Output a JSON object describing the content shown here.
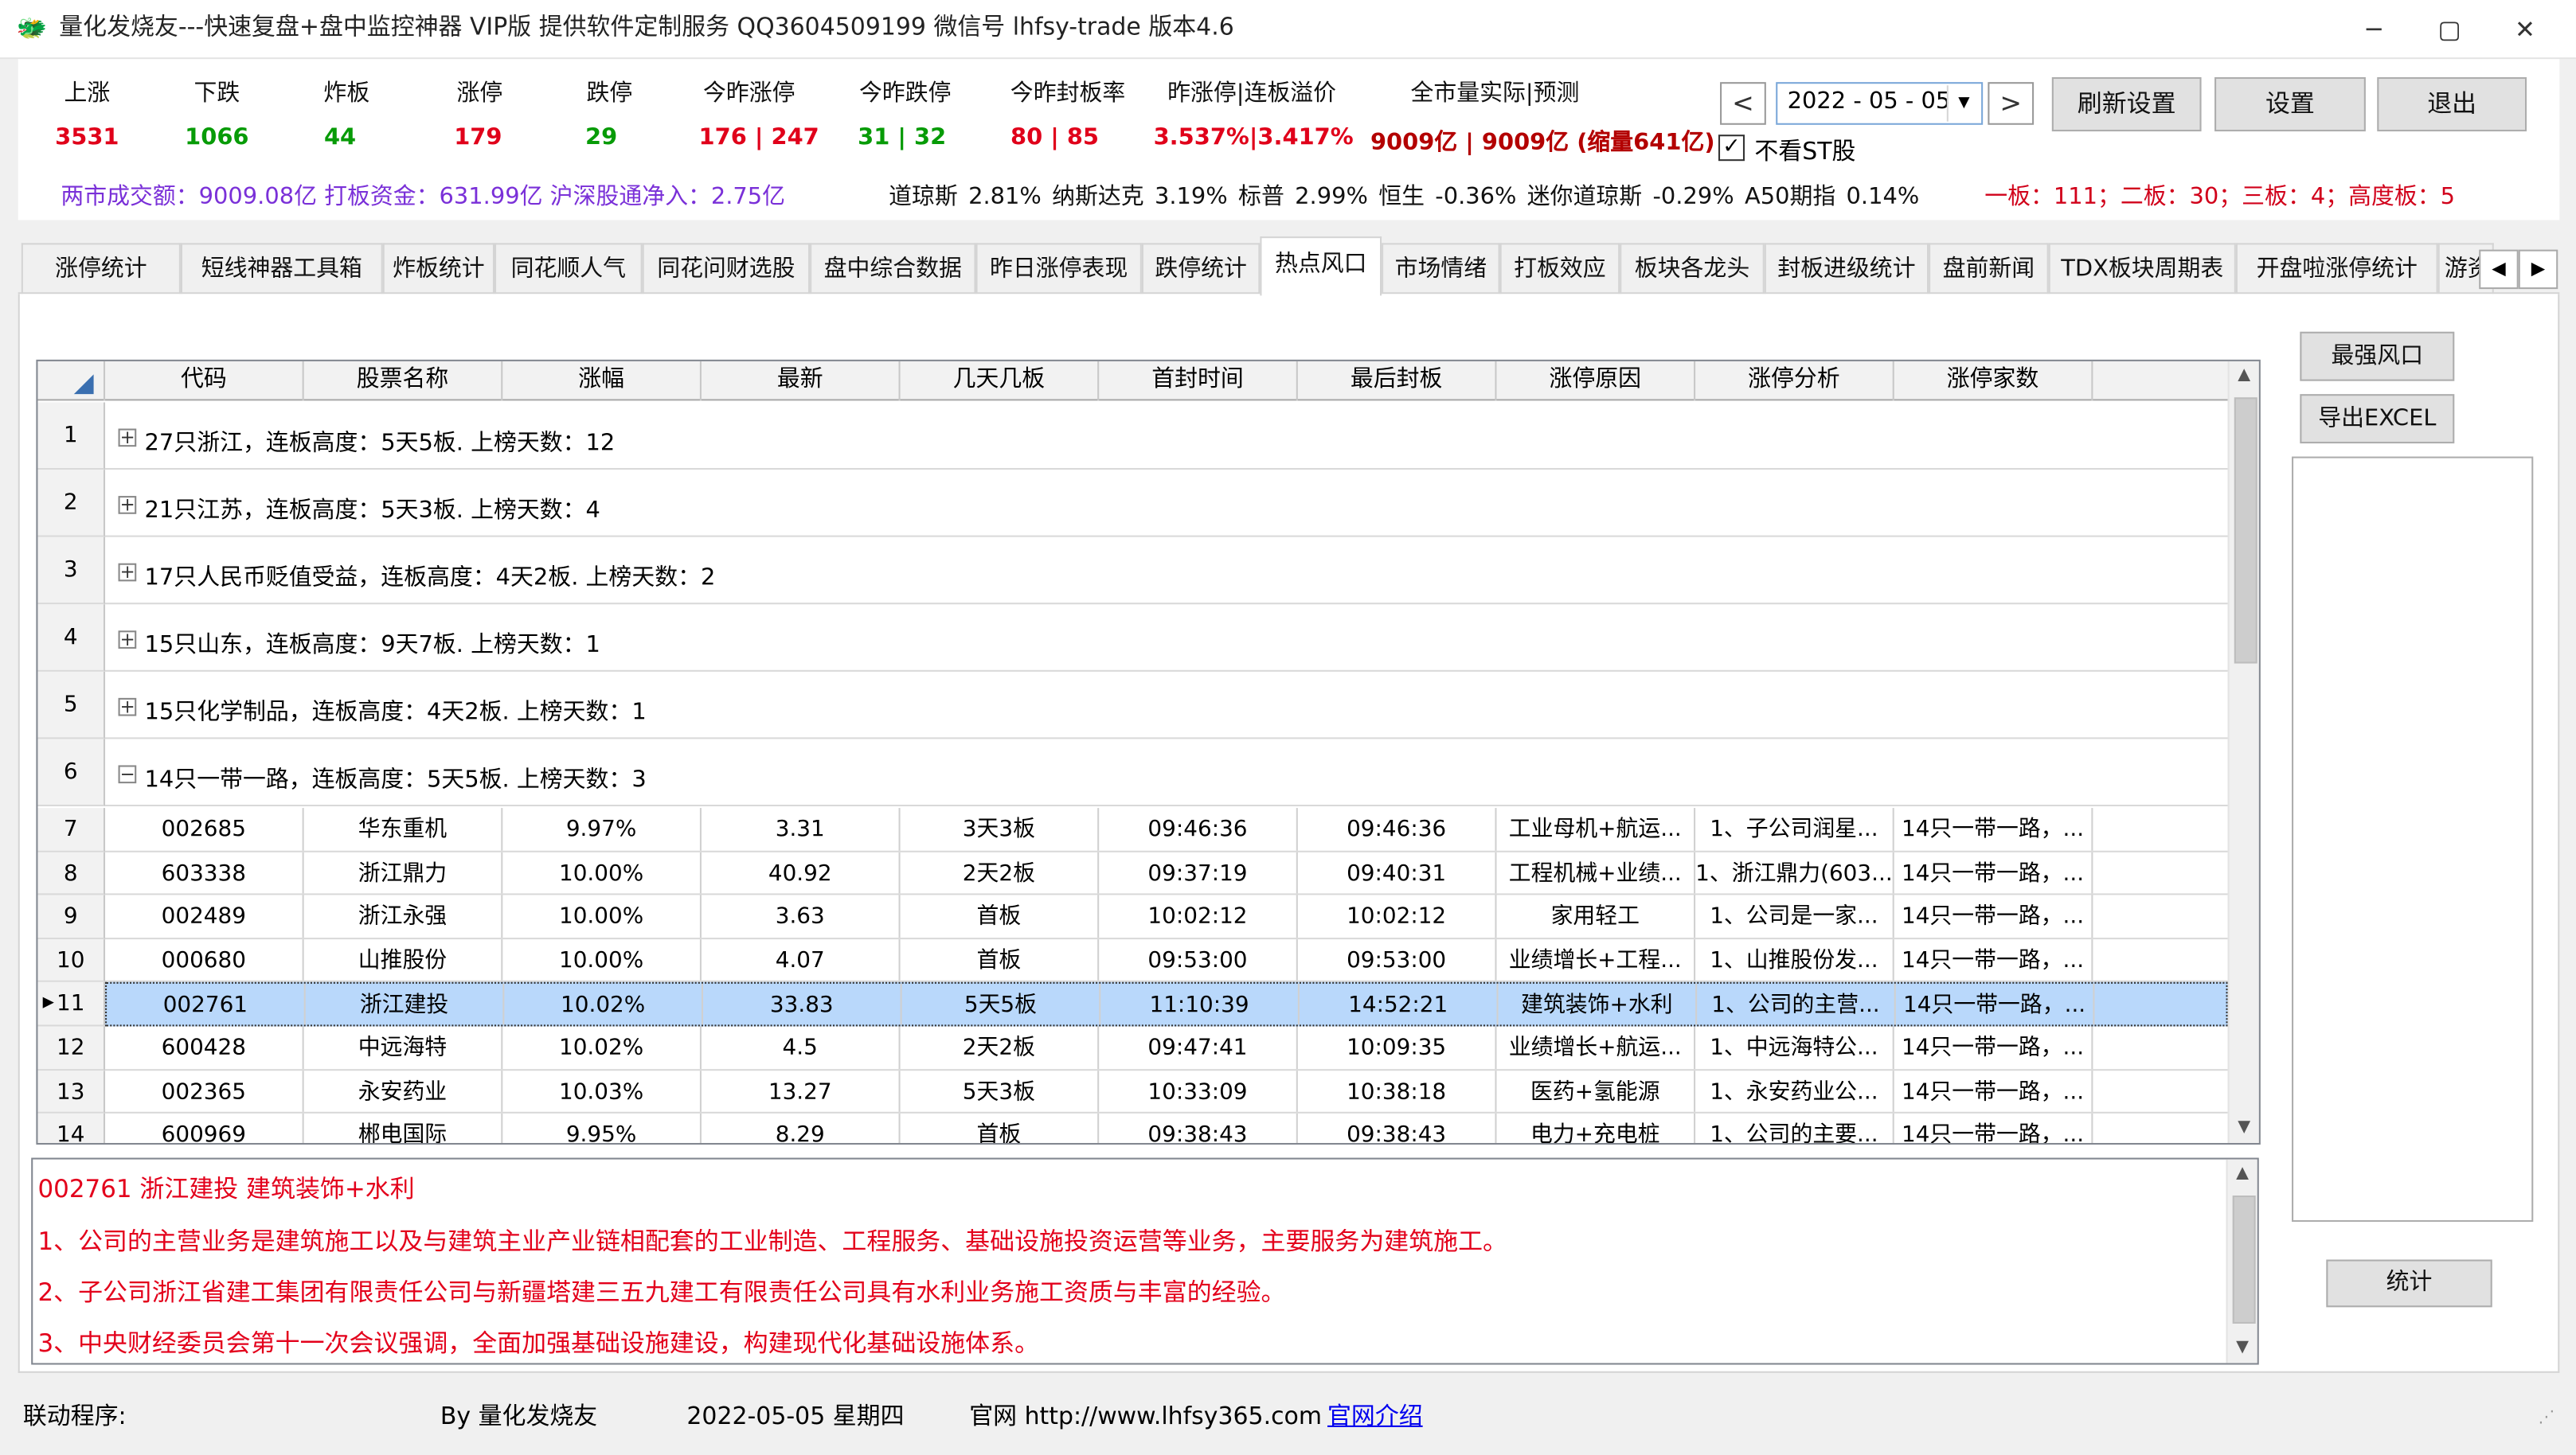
{
  "window": {
    "title": "量化发烧友---快速复盘+盘中监控神器 VIP版  提供软件定制服务 QQ3604509199 微信号 lhfsy-trade   版本4.6",
    "minimize": "─",
    "maximize": "▢",
    "close": "✕"
  },
  "stats": {
    "labels": [
      "上涨",
      "下跌",
      "炸板",
      "涨停",
      "跌停",
      "今昨涨停",
      "今昨跌停",
      "今昨封板率",
      "昨涨停|连板溢价",
      "全市量实际|预测"
    ],
    "values": [
      "3531",
      "1066",
      "44",
      "179",
      "29",
      "176 | 247",
      "31 | 32",
      "80 | 85",
      "3.537%|3.417%",
      "9009亿 | 9009亿 (缩量641亿)"
    ],
    "line2a": "两市成交额：9009.08亿   打板资金：631.99亿   沪深股通净入：2.75亿",
    "line2b": "道琼斯 2.81%   纳斯达克 3.19%   标普 2.99%   恒生 -0.36%   迷你道琼斯 -0.29%   A50期指 0.14%",
    "line2c": "一板：111；二板：30；三板：4；高度板：5"
  },
  "controls": {
    "prev": "<",
    "next": ">",
    "date": "2022 - 05 - 05",
    "refresh": "刷新设置",
    "settings": "设置",
    "exit": "退出",
    "no_st": "不看ST股",
    "check": "✓"
  },
  "tabs": [
    "涨停统计",
    "短线神器工具箱",
    "炸板统计",
    "同花顺人气",
    "同花问财选股",
    "盘中综合数据",
    "昨日涨停表现",
    "跌停统计",
    "热点风口",
    "市场情绪",
    "打板效应",
    "板块各龙头",
    "封板进级统计",
    "盘前新闻",
    "TDX板块周期表",
    "开盘啦涨停统计",
    "游资"
  ],
  "active_tab": "热点风口",
  "grid": {
    "columns": [
      "代码",
      "股票名称",
      "涨幅",
      "最新",
      "几天几板",
      "首封时间",
      "最后封板",
      "涨停原因",
      "涨停分析",
      "涨停家数"
    ],
    "groups": [
      {
        "num": "1",
        "text": "27只浙江，连板高度：5天5板. 上榜天数：12",
        "sign": "+"
      },
      {
        "num": "2",
        "text": "21只江苏，连板高度：5天3板. 上榜天数：4",
        "sign": "+"
      },
      {
        "num": "3",
        "text": "17只人民币贬值受益，连板高度：4天2板. 上榜天数：2",
        "sign": "+"
      },
      {
        "num": "4",
        "text": "15只山东，连板高度：9天7板. 上榜天数：1",
        "sign": "+"
      },
      {
        "num": "5",
        "text": "15只化学制品，连板高度：4天2板. 上榜天数：1",
        "sign": "+"
      },
      {
        "num": "6",
        "text": "14只一带一路，连板高度：5天5板. 上榜天数：3",
        "sign": "−"
      }
    ],
    "rows": [
      {
        "num": "7",
        "cells": [
          "002685",
          "华东重机",
          "9.97%",
          "3.31",
          "3天3板",
          "09:46:36",
          "09:46:36",
          "工业母机+航运...",
          "1、子公司润星...",
          "14只一带一路，..."
        ]
      },
      {
        "num": "8",
        "cells": [
          "603338",
          "浙江鼎力",
          "10.00%",
          "40.92",
          "2天2板",
          "09:37:19",
          "09:40:31",
          "工程机械+业绩...",
          "1、浙江鼎力(603...",
          "14只一带一路，..."
        ]
      },
      {
        "num": "9",
        "cells": [
          "002489",
          "浙江永强",
          "10.00%",
          "3.63",
          "首板",
          "10:02:12",
          "10:02:12",
          "家用轻工",
          "1、公司是一家...",
          "14只一带一路，..."
        ]
      },
      {
        "num": "10",
        "cells": [
          "000680",
          "山推股份",
          "10.00%",
          "4.07",
          "首板",
          "09:53:00",
          "09:53:00",
          "业绩增长+工程...",
          "1、山推股份发...",
          "14只一带一路，..."
        ]
      },
      {
        "num": "11",
        "cells": [
          "002761",
          "浙江建投",
          "10.02%",
          "33.83",
          "5天5板",
          "11:10:39",
          "14:52:21",
          "建筑装饰+水利",
          "1、公司的主营...",
          "14只一带一路，..."
        ],
        "selected": true
      },
      {
        "num": "12",
        "cells": [
          "600428",
          "中远海特",
          "10.02%",
          "4.5",
          "2天2板",
          "09:47:41",
          "10:09:35",
          "业绩增长+航运...",
          "1、中远海特公...",
          "14只一带一路，..."
        ]
      },
      {
        "num": "13",
        "cells": [
          "002365",
          "永安药业",
          "10.03%",
          "13.27",
          "5天3板",
          "10:33:09",
          "10:38:18",
          "医药+氢能源",
          "1、永安药业公...",
          "14只一带一路，..."
        ]
      },
      {
        "num": "14",
        "cells": [
          "600969",
          "郴电国际",
          "9.95%",
          "8.29",
          "首板",
          "09:38:43",
          "09:38:43",
          "电力+充电桩",
          "1、公司的主要...",
          "14只一带一路，..."
        ]
      }
    ]
  },
  "detail": [
    "002761 浙江建投 建筑装饰+水利",
    "1、公司的主营业务是建筑施工以及与建筑主业产业链相配套的工业制造、工程服务、基础设施投资运营等业务，主要服务为建筑施工。",
    "2、子公司浙江省建工集团有限责任公司与新疆塔建三五九建工有限责任公司具有水利业务施工资质与丰富的经验。",
    "3、中央财经委员会第十一次会议强调，全面加强基础设施建设，构建现代化基础设施体系。"
  ],
  "side": {
    "strongest": "最强风口",
    "export": "导出EXCEL",
    "stats": "统计"
  },
  "status": {
    "linked": "联动程序:",
    "by": "By 量化发烧友",
    "date": "2022-05-05 星期四",
    "site": "官网 http://www.lhfsy365.com",
    "intro": "官网介绍"
  },
  "colors": {
    "up": "#e0001a",
    "down": "#079b07",
    "selected": "#b9d8fb",
    "link": "#0000ee"
  }
}
